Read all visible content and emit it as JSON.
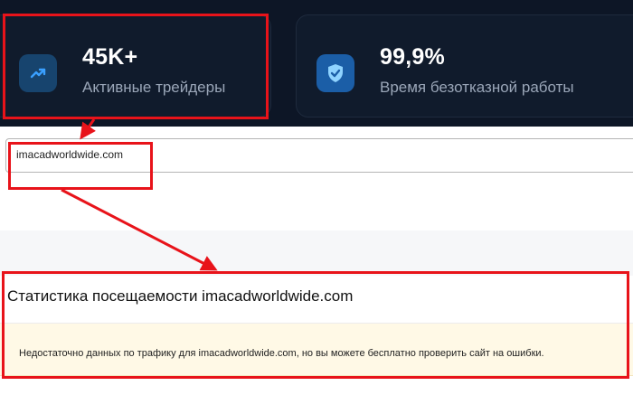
{
  "stats": [
    {
      "value": "45K+",
      "label": "Активные трейдеры",
      "icon": "trending-up-icon"
    },
    {
      "value": "99,9%",
      "label": "Время безотказной работы",
      "icon": "shield-check-icon"
    }
  ],
  "search": {
    "value": "imacadworldwide.com"
  },
  "traffic": {
    "title": "Статистика посещаемости imacadworldwide.com",
    "notice": "Недостаточно данных по трафику для imacadworldwide.com, но вы можете бесплатно проверить сайт на ошибки."
  },
  "colors": {
    "accent_red": "#e8131a",
    "dark_bg": "#0d1626",
    "shield_blue": "#1b5ea7"
  }
}
